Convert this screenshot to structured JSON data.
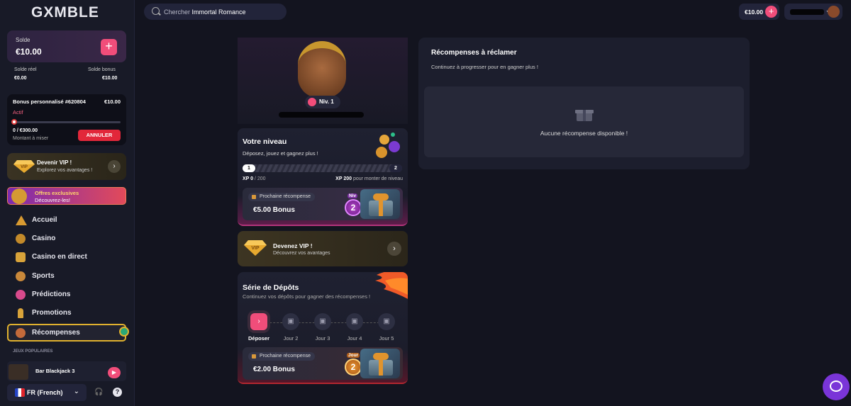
{
  "brand": {
    "logo": "GXMBLE"
  },
  "sidebar": {
    "balance": {
      "label": "Solde",
      "value": "€10.00",
      "real_label": "Solde réel",
      "real_value": "€0.00",
      "bonus_label": "Solde bonus",
      "bonus_value": "€10.00"
    },
    "bonus": {
      "title": "Bonus personnalisé #620804",
      "amount": "€10.00",
      "status": "Actif",
      "progress": "0 / €300.00",
      "progress_sub": "Montant à miser",
      "cancel_label": "ANNULER",
      "progress_fraction": 0
    },
    "vip": {
      "title": "Devenir VIP !",
      "subtitle": "Explorez vos avantages !",
      "gem_text": "VIP"
    },
    "offer": {
      "title": "Offres exclusives",
      "subtitle": "Découvrez-les!"
    },
    "nav": [
      {
        "label": "Accueil",
        "icon": "pyramid-icon"
      },
      {
        "label": "Casino",
        "icon": "casino-chip-icon"
      },
      {
        "label": "Casino en direct",
        "icon": "dice-icon"
      },
      {
        "label": "Sports",
        "icon": "ball-icon"
      },
      {
        "label": "Prédictions",
        "icon": "trend-icon"
      },
      {
        "label": "Promotions",
        "icon": "ankh-icon"
      },
      {
        "label": "Récompenses",
        "icon": "medal-icon",
        "active": true
      }
    ],
    "popular_label": "JEUX POPULAIRES",
    "popular_game": "Bar Blackjack 3",
    "language": "FR (French)"
  },
  "header": {
    "search_placeholder": "Chercher ",
    "search_highlight": "Immortal Romance",
    "balance": "€10.00"
  },
  "level": {
    "badge": "Niv. 1",
    "title": "Votre niveau",
    "subtitle": "Déposez, jouez et gagnez plus !",
    "xp_start": "1",
    "xp_end": "2",
    "xp_current_label": "XP 0",
    "xp_current_total": " / 200",
    "xp_needed_label": "XP 200",
    "xp_needed_sub": " pour monter de niveau",
    "next_reward_label": "Prochaine récompense",
    "next_reward_amount": "€5.00 Bonus",
    "next_level_tag": "Niv",
    "next_level": "2"
  },
  "vip_promo": {
    "title": "Devenez VIP !",
    "subtitle": "Découvrez vos avantages",
    "gem_text": "VIP"
  },
  "streak": {
    "title": "Série de Dépôts",
    "subtitle": "Continuez vos dépôts pour gagner des récompenses !",
    "days": [
      "Déposer",
      "Jour 2",
      "Jour 3",
      "Jour 4",
      "Jour 5"
    ],
    "next_reward_label": "Prochaine récompense",
    "next_reward_amount": "€2.00 Bonus",
    "day_tag": "Jour",
    "day_number": "2"
  },
  "rewards": {
    "title": "Récompenses à réclamer",
    "subtitle": "Continuez à progresser pour en gagner plus !",
    "empty_text": "Aucune récompense disponible !"
  },
  "colors": {
    "accent": "#f14d7a",
    "gold": "#e0b12e",
    "background": "#13141f"
  }
}
